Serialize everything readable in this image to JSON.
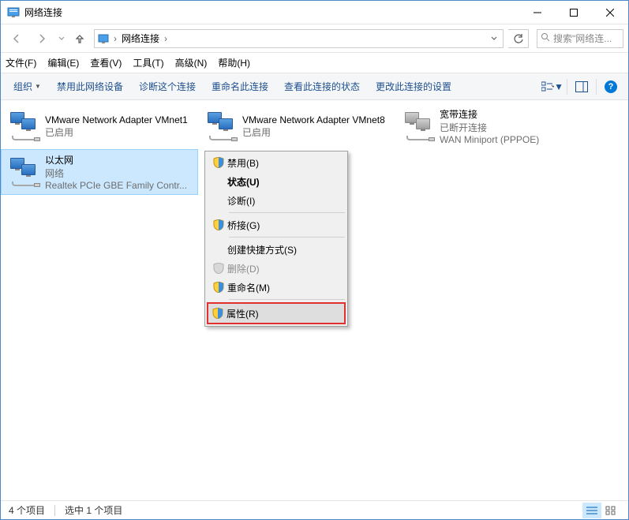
{
  "window": {
    "title": "网络连接"
  },
  "breadcrumb": {
    "location": "网络连接"
  },
  "search": {
    "placeholder": "搜索\"网络连..."
  },
  "menubar": {
    "file": "文件(F)",
    "edit": "编辑(E)",
    "view": "查看(V)",
    "tools": "工具(T)",
    "advanced": "高级(N)",
    "help": "帮助(H)"
  },
  "toolbar": {
    "organize": "组织",
    "disable_device": "禁用此网络设备",
    "diagnose": "诊断这个连接",
    "rename": "重命名此连接",
    "view_status": "查看此连接的状态",
    "change_settings": "更改此连接的设置"
  },
  "items": [
    {
      "name": "VMware Network Adapter VMnet1",
      "status": "已启用",
      "detail": ""
    },
    {
      "name": "VMware Network Adapter VMnet8",
      "status": "已启用",
      "detail": ""
    },
    {
      "name": "宽带连接",
      "status": "已断开连接",
      "detail": "WAN Miniport (PPPOE)"
    },
    {
      "name": "以太网",
      "status": "网络",
      "detail": "Realtek PCIe GBE Family Contr..."
    }
  ],
  "context_menu": {
    "disable": "禁用(B)",
    "status": "状态(U)",
    "diagnose": "诊断(I)",
    "bridge": "桥接(G)",
    "shortcut": "创建快捷方式(S)",
    "delete": "删除(D)",
    "rename": "重命名(M)",
    "properties": "属性(R)"
  },
  "statusbar": {
    "count": "4 个项目",
    "selected": "选中 1 个项目"
  }
}
